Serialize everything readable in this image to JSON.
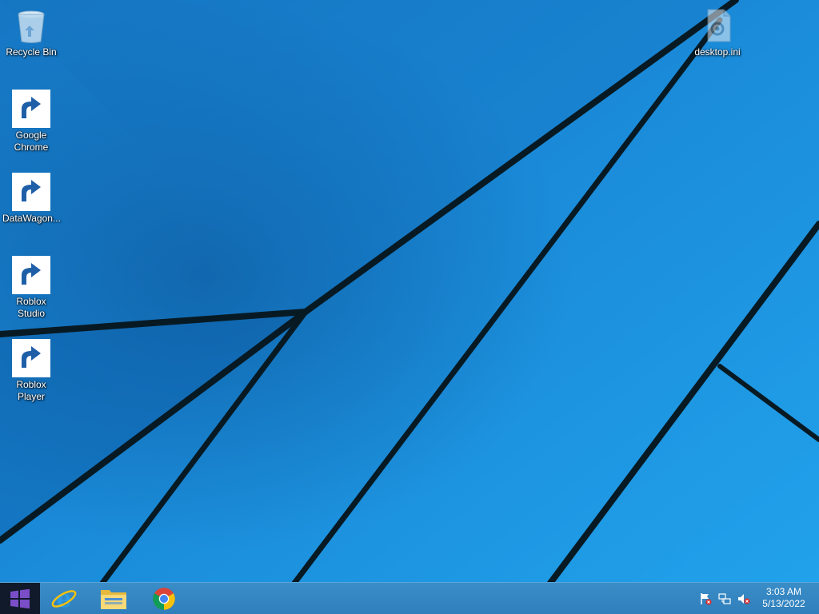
{
  "desktop": {
    "icons": [
      {
        "label": "Recycle Bin",
        "icon": "recycle-bin-icon"
      },
      {
        "label": "Google Chrome",
        "icon": "chrome-icon"
      },
      {
        "label": "DataWagon...",
        "icon": "datawagon-icon"
      },
      {
        "label": "Roblox Studio",
        "icon": "roblox-studio-icon"
      },
      {
        "label": "Roblox Player",
        "icon": "roblox-player-icon"
      },
      {
        "label": "desktop.ini",
        "icon": "settings-file-icon"
      }
    ]
  },
  "taskbar": {
    "start_icon": "windows-logo-icon",
    "pinned": [
      {
        "icon": "internet-explorer-icon"
      },
      {
        "icon": "file-explorer-icon"
      },
      {
        "icon": "chrome-icon"
      }
    ],
    "tray": [
      {
        "icon": "action-center-flag-icon"
      },
      {
        "icon": "network-icon"
      },
      {
        "icon": "volume-muted-icon"
      }
    ],
    "clock": {
      "time": "3:03 AM",
      "date": "5/13/2022"
    }
  },
  "colors": {
    "wallpaper_blue": "#1a8ad8",
    "taskbar_blue": "#3586c2",
    "start_dark": "#101a2b"
  }
}
